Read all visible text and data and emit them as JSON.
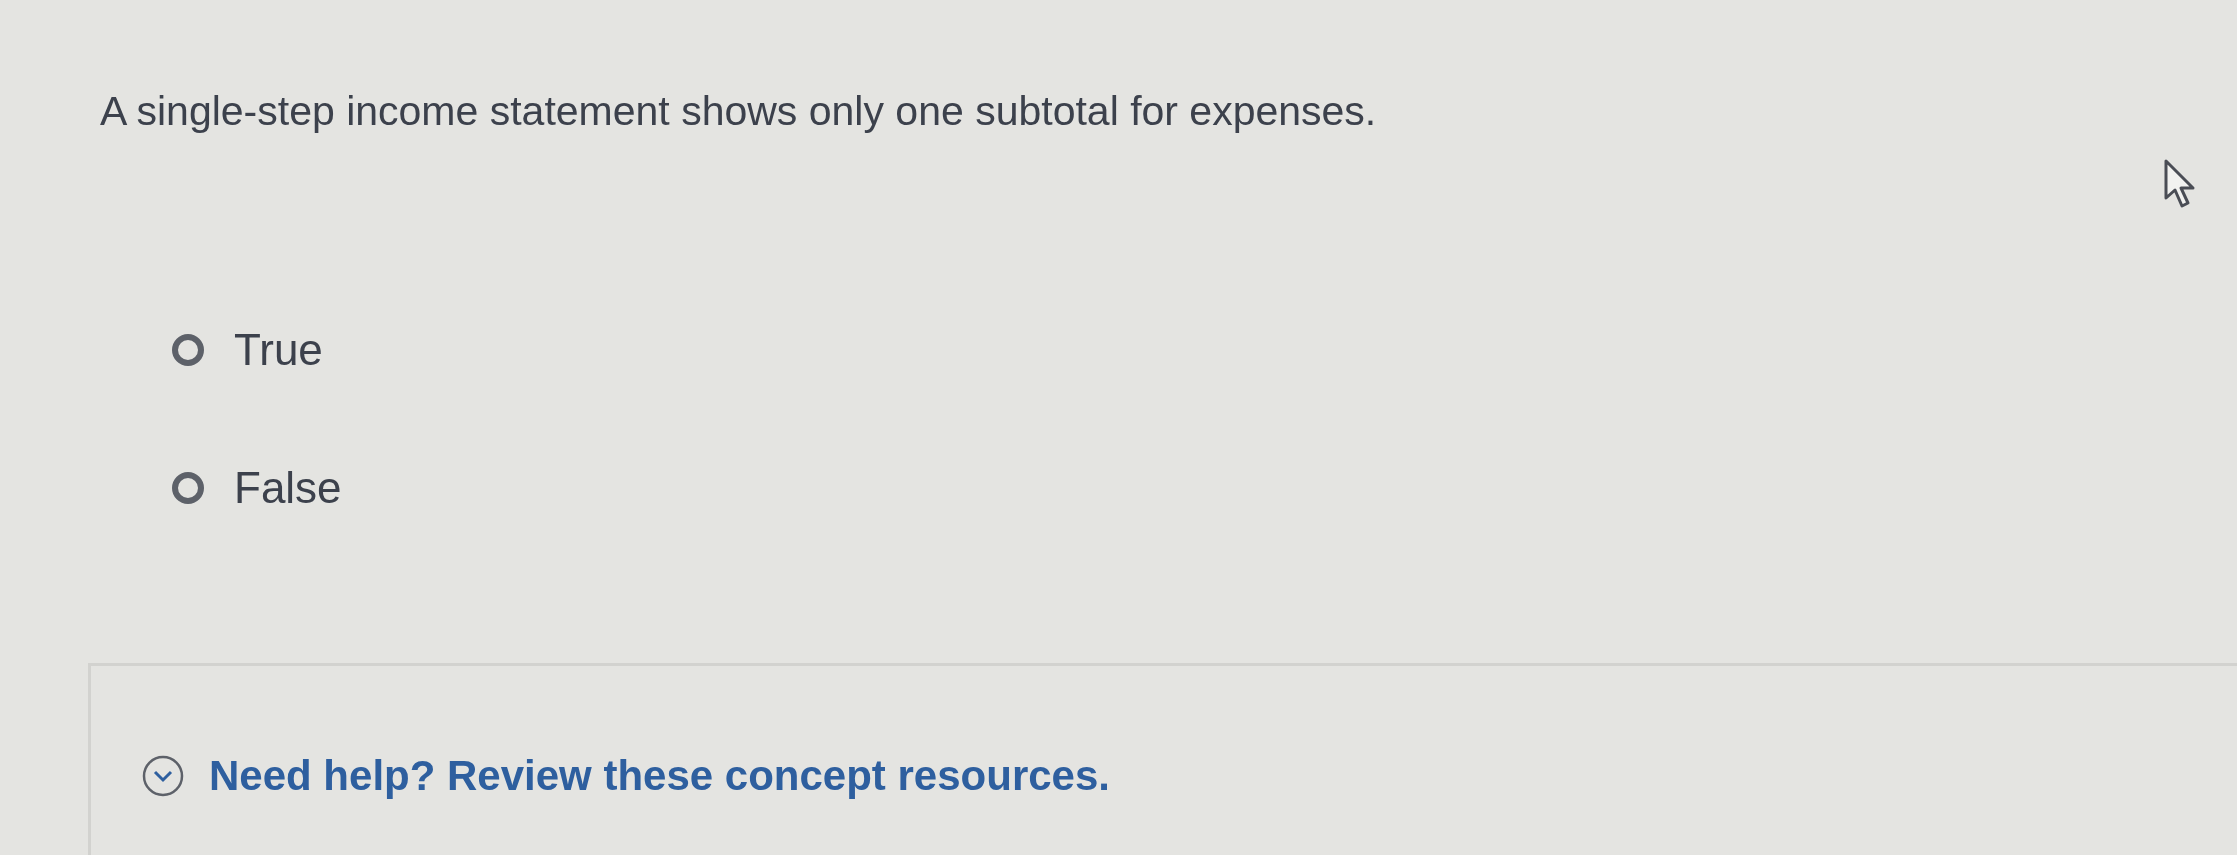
{
  "question": "A single-step income statement shows only one subtotal for expenses.",
  "options": [
    {
      "label": "True",
      "selected": false
    },
    {
      "label": "False",
      "selected": false
    }
  ],
  "help": {
    "label": "Need help? Review these concept resources.",
    "expanded": false
  }
}
